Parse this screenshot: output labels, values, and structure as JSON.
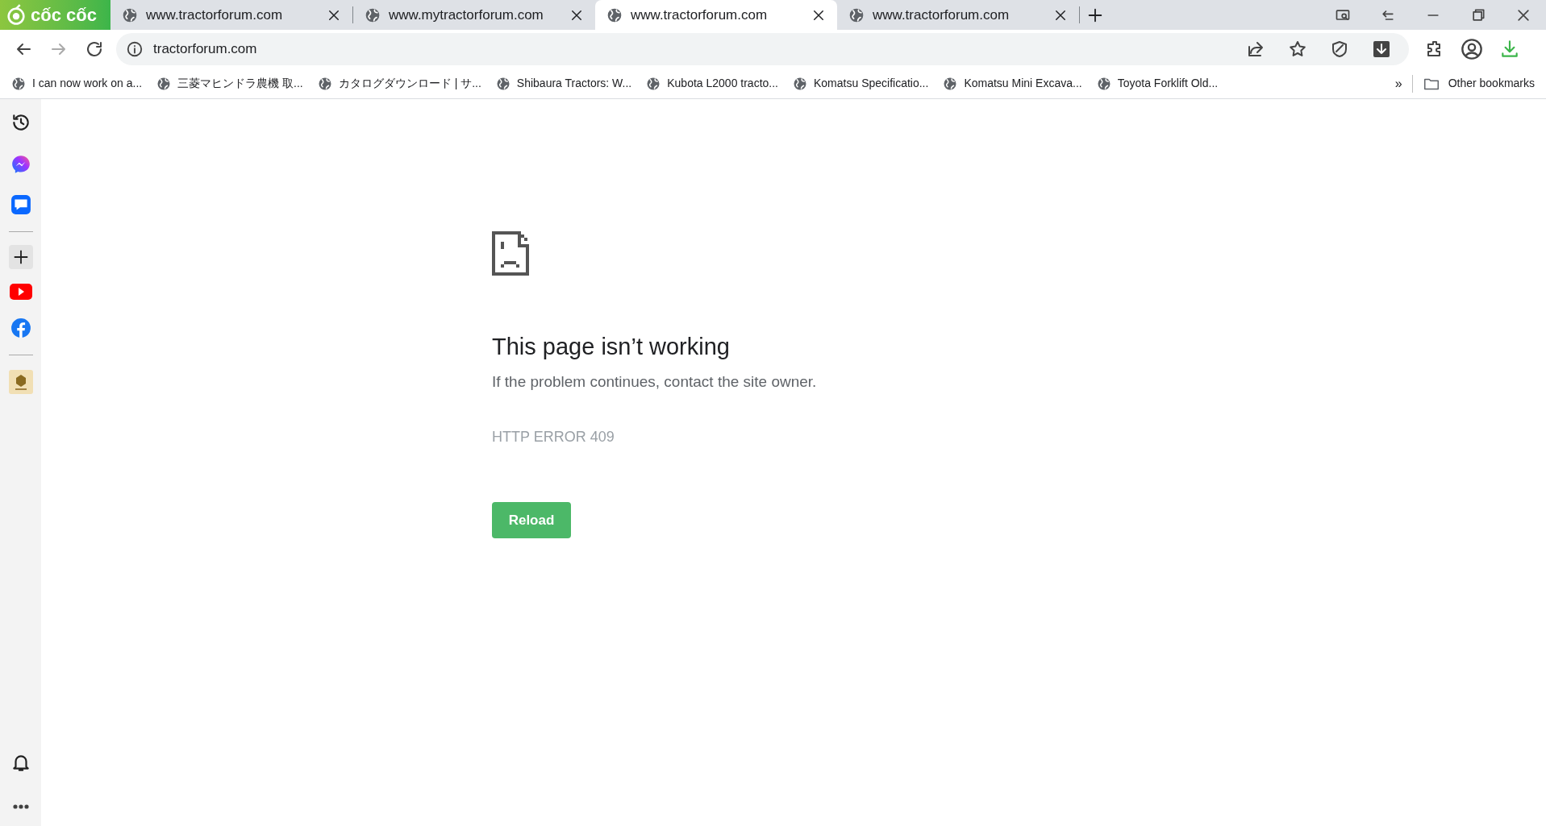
{
  "browser": {
    "logo": "cốc cốc"
  },
  "tabs": [
    {
      "title": "www.tractorforum.com",
      "selected": false
    },
    {
      "title": "www.mytractorforum.com",
      "selected": false
    },
    {
      "title": "www.tractorforum.com",
      "selected": true
    },
    {
      "title": "www.tractorforum.com",
      "selected": false
    }
  ],
  "address_bar": {
    "url": "tractorforum.com"
  },
  "bookmarks": [
    {
      "title": "I can now work on a..."
    },
    {
      "title": "三菱マヒンドラ農機 取..."
    },
    {
      "title": "カタログダウンロード | サ..."
    },
    {
      "title": "Shibaura Tractors: W..."
    },
    {
      "title": "Kubota L2000 tracto..."
    },
    {
      "title": "Komatsu Specificatio..."
    },
    {
      "title": "Komatsu Mini Excava..."
    },
    {
      "title": "Toyota Forklift Old..."
    }
  ],
  "bookmarks_overflow": "»",
  "other_bookmarks": "Other bookmarks",
  "error_page": {
    "heading": "This page isn’t working",
    "message": "If the problem continues, contact the site owner.",
    "error_code": "HTTP ERROR 409",
    "button": "Reload"
  }
}
